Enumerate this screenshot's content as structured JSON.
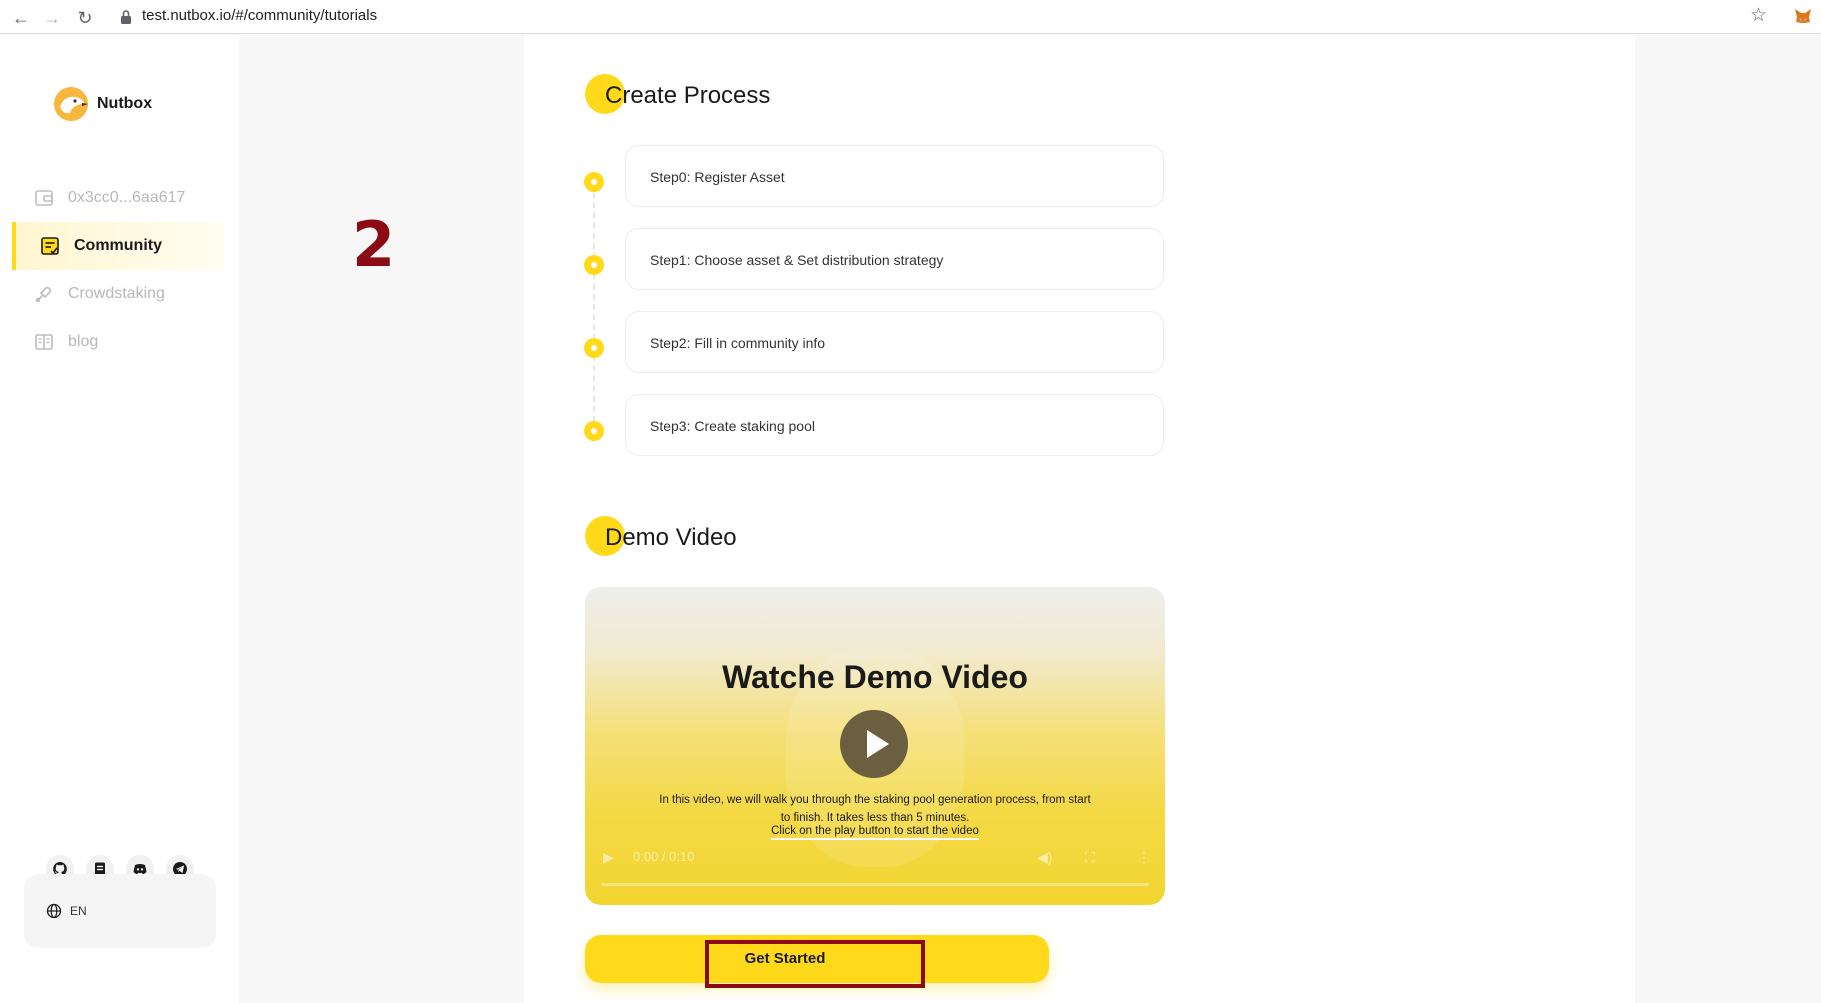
{
  "browser": {
    "url": "test.nutbox.io/#/community/tutorials"
  },
  "sidebar": {
    "brand": "Nutbox",
    "items": [
      {
        "label": "0x3cc0...6aa617",
        "icon": "wallet-icon",
        "active": false
      },
      {
        "label": "Community",
        "icon": "community-icon",
        "active": true
      },
      {
        "label": "Crowdstaking",
        "icon": "crowdstaking-icon",
        "active": false
      },
      {
        "label": "blog",
        "icon": "blog-icon",
        "active": false
      }
    ],
    "social": [
      "github-icon",
      "docs-icon",
      "discord-icon",
      "telegram-icon"
    ],
    "language": "EN"
  },
  "annotation": {
    "step_number": "2"
  },
  "create_process": {
    "title": "Create Process",
    "steps": [
      "Step0: Register Asset",
      "Step1: Choose asset & Set distribution strategy",
      "Step2: Fill in community info",
      "Step3: Create staking pool"
    ]
  },
  "demo_video": {
    "section_title": "Demo Video",
    "video_title": "Watche Demo Video",
    "description": "In this video, we will walk you through the staking pool generation process, from start to finish. It takes less than 5 minutes.",
    "link_text": "Click on the play button to start the video",
    "time": "0:00 / 0:10"
  },
  "actions": {
    "get_started": "Get Started"
  },
  "colors": {
    "accent": "#ffd91a",
    "annotation": "#8b0a14"
  }
}
